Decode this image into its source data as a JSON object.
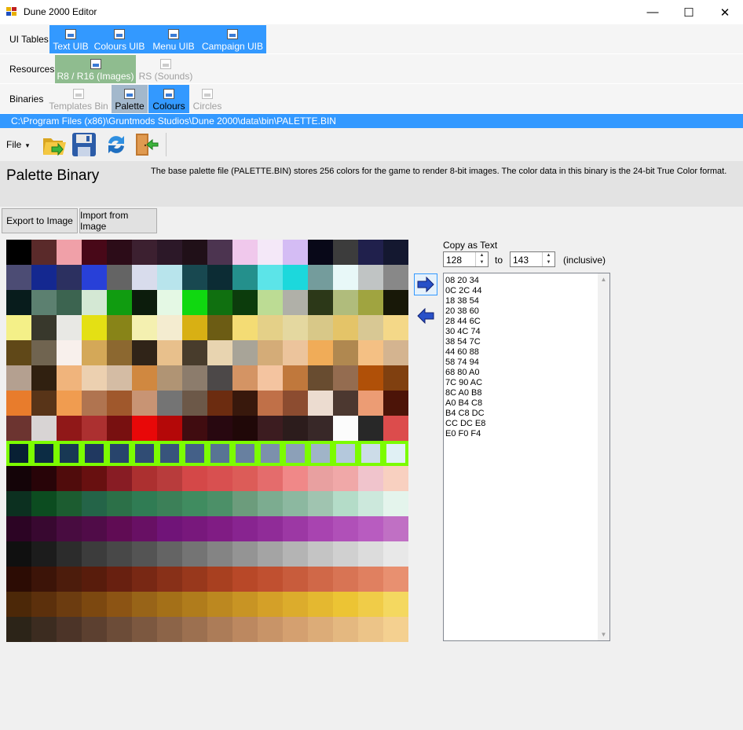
{
  "window": {
    "title": "Dune 2000 Editor",
    "controls": {
      "minimize": "—",
      "maximize": "☐",
      "close": "✕"
    }
  },
  "ui_tables": {
    "label": "UI Tables",
    "tabs": [
      "Text UIB",
      "Colours UIB",
      "Menu UIB",
      "Campaign UIB"
    ]
  },
  "resources": {
    "label": "Resources",
    "tabs": [
      "R8 / R16 (Images)",
      "RS (Sounds)"
    ]
  },
  "binaries": {
    "label": "Binaries",
    "tabs": [
      "Templates Bin",
      "Palette",
      "Colours",
      "Circles"
    ]
  },
  "path": "C:\\Program Files (x86)\\Gruntmods Studios\\Dune 2000\\data\\bin\\PALETTE.BIN",
  "toolbar": {
    "file_label": "File",
    "file_arrow": "▾",
    "icons": [
      "open-folder-icon",
      "save-icon",
      "refresh-icon",
      "exit-door-icon"
    ]
  },
  "info": {
    "heading": "Palette Binary",
    "description": "The base palette file (PALETTE.BIN) stores 256 colors for the game to render 8-bit images. The color data in this binary is the 24-bit True Color format."
  },
  "buttons": {
    "export": "Export to Image",
    "import": "Import from Image"
  },
  "copy": {
    "label": "Copy as Text",
    "from": "128",
    "to_label": "to",
    "to": "143",
    "inclusive": "(inclusive)",
    "text": "08 20 34\n0C 2C 44\n18 38 54\n20 38 60\n28 44 6C\n30 4C 74\n38 54 7C\n44 60 88\n58 74 94\n68 80 A0\n7C 90 AC\n8C A0 B8\nA0 B4 C8\nB4 C8 DC\nCC DC E8\nE0 F0 F4"
  },
  "selected_range": [
    128,
    143
  ],
  "palette": [
    "#000000",
    "#5a2a2a",
    "#f0a0a8",
    "#480818",
    "#2c0c18",
    "#3c2030",
    "#2c1828",
    "#201018",
    "#4c3450",
    "#f0c8ec",
    "#f4e8f8",
    "#d4bcf4",
    "#080818",
    "#3c3c3c",
    "#20204c",
    "#141830",
    "#4c4c74",
    "#142890",
    "#2c3060",
    "#2840d8",
    "#646464",
    "#d8dcec",
    "#b8e4ec",
    "#184850",
    "#0c2c34",
    "#24908c",
    "#5ce4e8",
    "#1cd8dc",
    "#749c9c",
    "#e8f8f8",
    "#c0c4c4",
    "#888888",
    "#081c1c",
    "#5c8070",
    "#3c6450",
    "#d4e8d4",
    "#109c10",
    "#0c1c0c",
    "#e4f8e4",
    "#10d810",
    "#107010",
    "#0c3c0c",
    "#bcdc94",
    "#b0b0a8",
    "#2c3818",
    "#b0bc7c",
    "#a0a440",
    "#181808",
    "#f4f088",
    "#38382c",
    "#e8e8e4",
    "#e4e014",
    "#888418",
    "#f4f0b0",
    "#f4ecd0",
    "#d8b014",
    "#6c5c14",
    "#f4dc74",
    "#e4d088",
    "#e4d8a0",
    "#d8c888",
    "#e4c468",
    "#d8c894",
    "#f4d888",
    "#604818",
    "#706450",
    "#f8f0ec",
    "#d4a858",
    "#8c6830",
    "#302418",
    "#e8c08c",
    "#483c2c",
    "#e8d4b0",
    "#a8a498",
    "#d4ac78",
    "#ecc49c",
    "#f0ac58",
    "#b08850",
    "#f4c084",
    "#d4b490",
    "#b4a090",
    "#302010",
    "#f0b47c",
    "#ecd0b0",
    "#d4bca4",
    "#d08840",
    "#b09474",
    "#8c7c6c",
    "#4c4848",
    "#d49464",
    "#f4c4a0",
    "#c0783c",
    "#684c30",
    "#946c50",
    "#b05008",
    "#804010",
    "#e87c2c",
    "#583418",
    "#f09c50",
    "#b07450",
    "#a0582c",
    "#c89474",
    "#747474",
    "#6c5848",
    "#6c2c10",
    "#38180c",
    "#c07048",
    "#8c4c30",
    "#ecdcd0",
    "#4c3830",
    "#ec9c74",
    "#4c1408",
    "#6c3430",
    "#d8d4d4",
    "#901818",
    "#ac3030",
    "#781010",
    "#e80808",
    "#b40808",
    "#400c10",
    "#280810",
    "#200808",
    "#3c1c20",
    "#2c1c1c",
    "#382828",
    "#fcfcfc",
    "#282828",
    "#dc4c4c",
    "#082034",
    "#0c2c44",
    "#183854",
    "#203860",
    "#28446c",
    "#304c74",
    "#38547c",
    "#446088",
    "#587494",
    "#6880a0",
    "#7c90ac",
    "#8ca0b8",
    "#a0b4c8",
    "#b4c8dc",
    "#ccdce8",
    "#e0f0f4",
    "#140408",
    "#280408",
    "#500c0c",
    "#681010",
    "#881c24",
    "#ac3030",
    "#b83c3c",
    "#d44848",
    "#d85050",
    "#dc5c58",
    "#e46c6c",
    "#f08888",
    "#e8a0a0",
    "#f0a8a8",
    "#f0c4cc",
    "#f8d0c0",
    "#0c3020",
    "#0c4c20",
    "#1c5c30",
    "#246448",
    "#2c7048",
    "#307c54",
    "#3c8058",
    "#408c60",
    "#4c9068",
    "#6c9c7c",
    "#7cac90",
    "#8cb8a0",
    "#a0c4b0",
    "#b4dcc8",
    "#cce8dc",
    "#e4f4ec",
    "#2c0424",
    "#380830",
    "#480c40",
    "#500c48",
    "#600c54",
    "#681064",
    "#701478",
    "#78187c",
    "#801c84",
    "#882490",
    "#902c98",
    "#9c38a4",
    "#a844b0",
    "#b050b8",
    "#b85cc0",
    "#c070c4",
    "#101010",
    "#1c1c1c",
    "#2c2c2c",
    "#3c3c3c",
    "#484848",
    "#545454",
    "#646464",
    "#747474",
    "#848484",
    "#949494",
    "#a4a4a4",
    "#b4b4b4",
    "#c4c4c4",
    "#d0d0d0",
    "#dcdcdc",
    "#e8e8e8",
    "#2c0c04",
    "#3c1408",
    "#4c1c0c",
    "#581c0c",
    "#682010",
    "#782814",
    "#883018",
    "#98381c",
    "#a84020",
    "#b84828",
    "#c05030",
    "#c85c3c",
    "#d06848",
    "#d87454",
    "#e08060",
    "#e89070",
    "#4c2808",
    "#5c300c",
    "#6c3c10",
    "#7c4810",
    "#8c5414",
    "#986418",
    "#a47018",
    "#b07c1c",
    "#bc8820",
    "#c89424",
    "#d4a028",
    "#dcac2c",
    "#e4b830",
    "#ecc434",
    "#f0cc48",
    "#f4d860",
    "#2c2418",
    "#3c2c20",
    "#4c3428",
    "#5c4030",
    "#6c4c38",
    "#7c5840",
    "#8c6448",
    "#9c7050",
    "#ac7c58",
    "#bc8860",
    "#c89468",
    "#d4a070",
    "#dcac78",
    "#e4b880",
    "#ecc488",
    "#f4d090"
  ]
}
